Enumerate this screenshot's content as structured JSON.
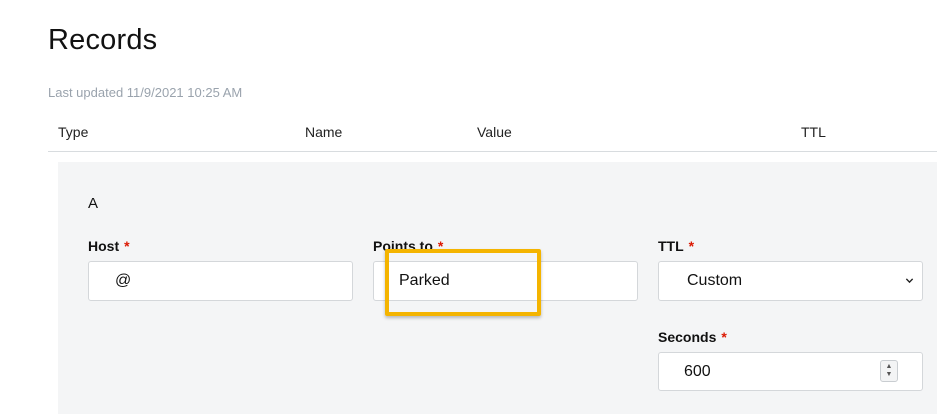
{
  "page": {
    "title": "Records",
    "last_updated": "Last updated 11/9/2021 10:25 AM"
  },
  "table_header": {
    "type": "Type",
    "name": "Name",
    "value": "Value",
    "ttl": "TTL"
  },
  "record_editor": {
    "record_type": "A",
    "host": {
      "label": "Host",
      "required_mark": "*",
      "value": "@"
    },
    "points_to": {
      "label": "Points to",
      "required_mark": "*",
      "value": "Parked"
    },
    "ttl": {
      "label": "TTL",
      "required_mark": "*",
      "selected": "Custom"
    },
    "seconds": {
      "label": "Seconds",
      "required_mark": "*",
      "value": "600"
    }
  },
  "colors": {
    "highlight": "#f4b400",
    "required": "#db1802",
    "panel_bg": "#f4f5f6"
  },
  "icons": {
    "select_arrow": "chevron-down-icon",
    "stepper": "number-stepper-icon"
  }
}
